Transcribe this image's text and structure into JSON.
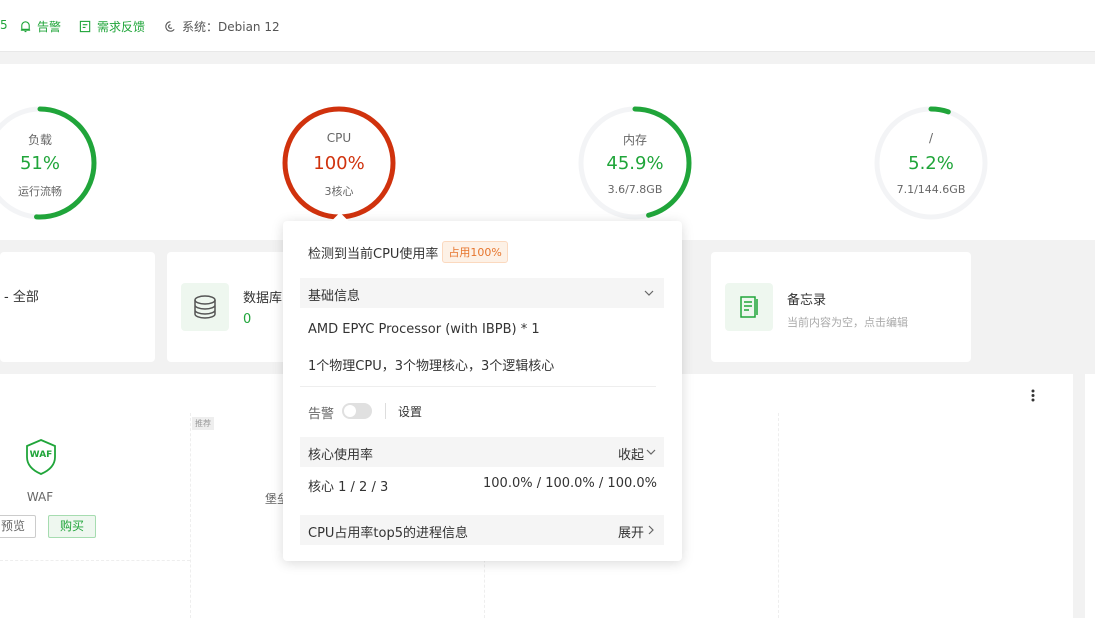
{
  "topbar": {
    "partial_item": "5",
    "alert_label": "告警",
    "feedback_label": "需求反馈",
    "system_label": "系统：Debian 12"
  },
  "gauges": [
    {
      "title": "负载",
      "value": "51%",
      "sub": "运行流畅",
      "percent": 0.51,
      "color": "#20a53a"
    },
    {
      "title": "CPU",
      "value": "100%",
      "sub": "3核心",
      "percent": 1.0,
      "color": "#d0320d"
    },
    {
      "title": "内存",
      "value": "45.9%",
      "sub": "3.6/7.8GB",
      "percent": 0.459,
      "color": "#20a53a"
    },
    {
      "title": "/",
      "value": "5.2%",
      "sub": "7.1/144.6GB",
      "percent": 0.052,
      "color": "#20a53a"
    }
  ],
  "cards": {
    "site_title": "- 全部",
    "db_title": "数据库",
    "db_value": "0",
    "memo_title": "备忘录",
    "memo_sub": "当前内容为空，点击编辑"
  },
  "software": {
    "recommend_tag": "推荐",
    "waf_icon_text": "WAF",
    "waf_name": "WAF",
    "preview_button": "预览",
    "buy_button": "购买",
    "partial_name": "堡垒"
  },
  "popup": {
    "heading": "检测到当前CPU使用率",
    "usage_badge": "占用100%",
    "basic_info_label": "基础信息",
    "cpu_model": "AMD EPYC Processor (with IBPB) * 1",
    "cpu_topology": "1个物理CPU，3个物理核心，3个逻辑核心",
    "alert_label": "告警",
    "settings_link": "设置",
    "core_usage_label": "核心使用率",
    "collapse_label": "收起",
    "core_list": "核心 1 / 2 / 3",
    "core_values": "100.0% / 100.0% / 100.0%",
    "top5_label": "CPU占用率top5的进程信息",
    "expand_label": "展开"
  }
}
